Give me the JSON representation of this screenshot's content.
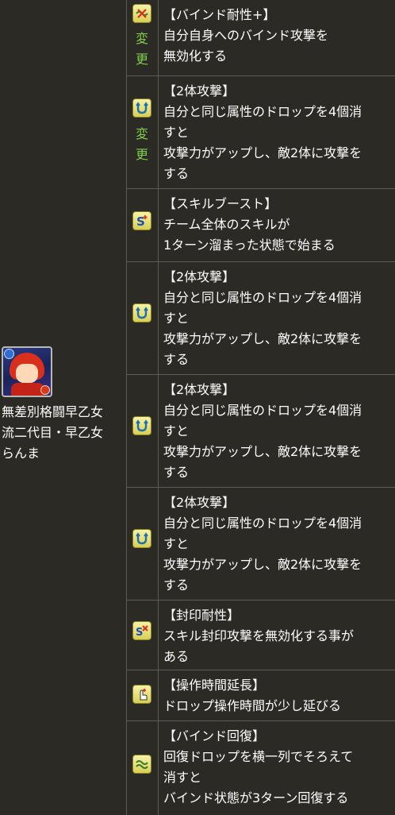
{
  "character": {
    "name": "無差別格闘早乙女\n流二代目・早乙女\nらんま"
  },
  "changed_label": {
    "top": "変",
    "bottom": "更"
  },
  "awakenings": [
    {
      "icon": "bind-resist-plus-icon",
      "changed": true,
      "title": "【バインド耐性+】",
      "desc": "自分自身へのバインド攻撃を\n無効化する"
    },
    {
      "icon": "two-prong-attack-icon",
      "changed": true,
      "title": "【2体攻撃】",
      "desc": "自分と同じ属性のドロップを4個消\nすと\n攻撃力がアップし、敵2体に攻撃を\nする"
    },
    {
      "icon": "skill-boost-icon",
      "changed": false,
      "title": "【スキルブースト】",
      "desc": "チーム全体のスキルが\n1ターン溜まった状態で始まる"
    },
    {
      "icon": "two-prong-attack-icon",
      "changed": false,
      "title": "【2体攻撃】",
      "desc": "自分と同じ属性のドロップを4個消\nすと\n攻撃力がアップし、敵2体に攻撃を\nする"
    },
    {
      "icon": "two-prong-attack-icon",
      "changed": false,
      "title": "【2体攻撃】",
      "desc": "自分と同じ属性のドロップを4個消\nすと\n攻撃力がアップし、敵2体に攻撃を\nする"
    },
    {
      "icon": "two-prong-attack-icon",
      "changed": false,
      "title": "【2体攻撃】",
      "desc": "自分と同じ属性のドロップを4個消\nすと\n攻撃力がアップし、敵2体に攻撃を\nする"
    },
    {
      "icon": "skill-bind-resist-icon",
      "changed": false,
      "title": "【封印耐性】",
      "desc": "スキル封印攻撃を無効化する事が\nある"
    },
    {
      "icon": "extend-time-icon",
      "changed": false,
      "title": "【操作時間延長】",
      "desc": "ドロップ操作時間が少し延びる"
    },
    {
      "icon": "bind-recovery-icon",
      "changed": false,
      "title": "【バインド回復】",
      "desc": "回復ドロップを横一列でそろえて\n消すと\nバインド状態が3ターン回復する"
    }
  ]
}
